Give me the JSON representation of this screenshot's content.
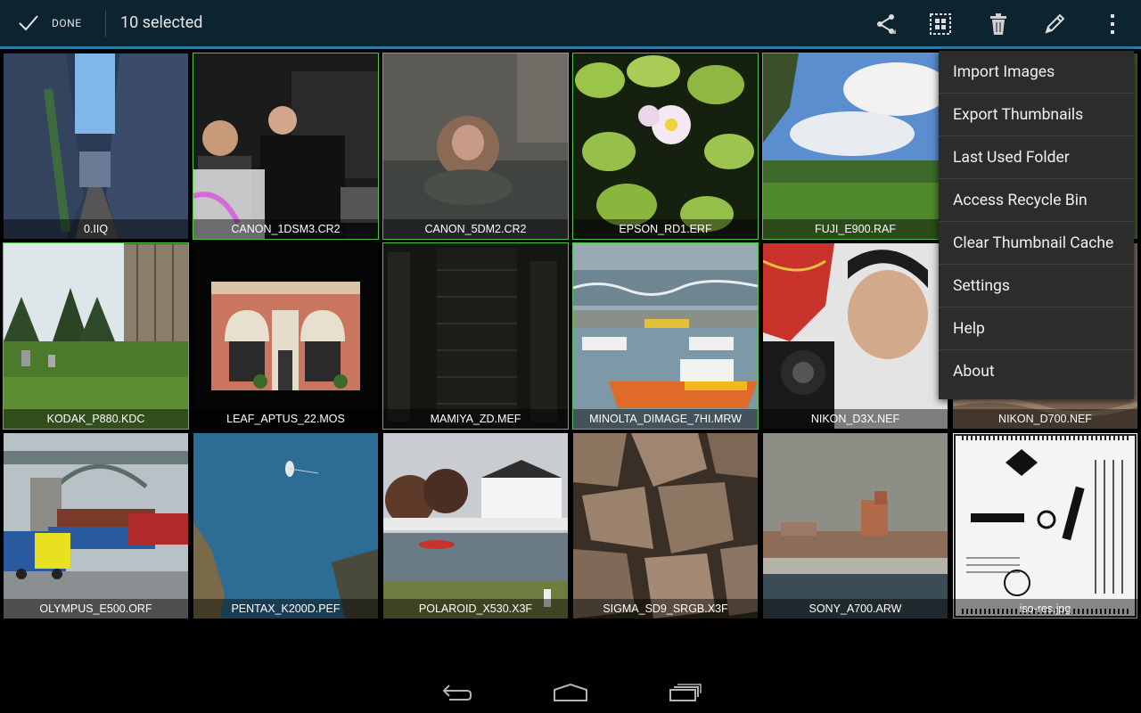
{
  "actionbar": {
    "done_label": "DONE",
    "selected_text": "10 selected",
    "icons": [
      "share-icon",
      "select-all-icon",
      "delete-icon",
      "edit-icon",
      "overflow-menu-icon"
    ],
    "accent_color": "#2e7ea6",
    "background_color": "#0b2430"
  },
  "grid": {
    "selection_color": "#47c840",
    "tiles": [
      {
        "caption": "0.IIQ",
        "selected": false
      },
      {
        "caption": "CANON_1DSM3.CR2",
        "selected": true
      },
      {
        "caption": "CANON_5DM2.CR2",
        "selected": true
      },
      {
        "caption": "EPSON_RD1.ERF",
        "selected": true
      },
      {
        "caption": "FUJI_E900.RAF",
        "selected": true
      },
      {
        "caption": "",
        "selected": false
      },
      {
        "caption": "KODAK_P880.KDC",
        "selected": true
      },
      {
        "caption": "LEAF_APTUS_22.MOS",
        "selected": false
      },
      {
        "caption": "MAMIYA_ZD.MEF",
        "selected": true
      },
      {
        "caption": "MINOLTA_DIMAGE_7HI.MRW",
        "selected": true
      },
      {
        "caption": "NIKON_D3X.NEF",
        "selected": false
      },
      {
        "caption": "NIKON_D700.NEF",
        "selected": false
      },
      {
        "caption": "OLYMPUS_E500.ORF",
        "selected": false
      },
      {
        "caption": "PENTAX_K200D.PEF",
        "selected": false
      },
      {
        "caption": "POLAROID_X530.X3F",
        "selected": false
      },
      {
        "caption": "SIGMA_SD9_SRGB.X3F",
        "selected": false
      },
      {
        "caption": "SONY_A700.ARW",
        "selected": false
      },
      {
        "caption": "iso-res.jpg",
        "selected": false
      }
    ]
  },
  "menu": {
    "items": [
      "Import Images",
      "Export Thumbnails",
      "Last Used Folder",
      "Access Recycle Bin",
      "Clear Thumbnail Cache",
      "Settings",
      "Help",
      "About"
    ]
  },
  "navbar": {
    "icons": [
      "back-icon",
      "home-icon",
      "recent-apps-icon"
    ]
  }
}
